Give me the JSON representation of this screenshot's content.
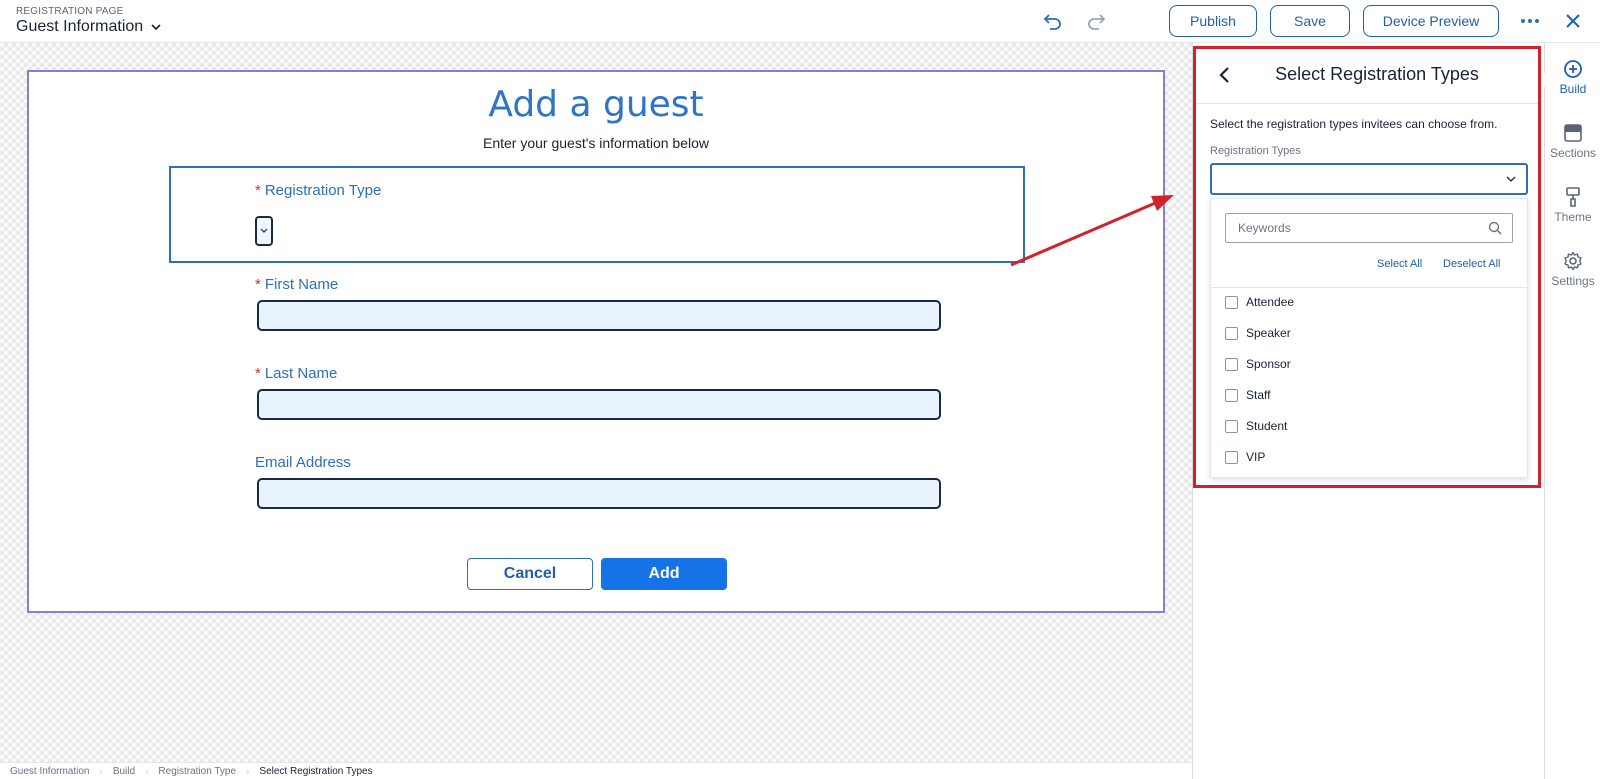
{
  "header": {
    "kicker": "REGISTRATION PAGE",
    "title": "Guest Information",
    "buttons": {
      "publish": "Publish",
      "save": "Save",
      "device_preview": "Device Preview"
    }
  },
  "form": {
    "title": "Add a guest",
    "subtitle": "Enter your guest's information below",
    "required_mark": "*",
    "fields": {
      "registration_type": "Registration Type",
      "first_name": "First Name",
      "last_name": "Last Name",
      "email": "Email Address"
    },
    "cancel_label": "Cancel",
    "add_label": "Add"
  },
  "panel": {
    "title": "Select Registration Types",
    "description": "Select the registration types invitees can choose from.",
    "dropdown_label": "Registration Types",
    "search_placeholder": "Keywords",
    "select_all": "Select All",
    "deselect_all": "Deselect All",
    "options": [
      "Attendee",
      "Speaker",
      "Sponsor",
      "Staff",
      "Student",
      "VIP"
    ]
  },
  "rail": {
    "items": [
      {
        "label": "Build",
        "icon": "plus-circle-icon",
        "active": true
      },
      {
        "label": "Sections",
        "icon": "sections-icon",
        "active": false
      },
      {
        "label": "Theme",
        "icon": "paint-roller-icon",
        "active": false
      },
      {
        "label": "Settings",
        "icon": "gear-icon",
        "active": false
      }
    ]
  },
  "breadcrumb": [
    "Guest Information",
    "Build",
    "Registration Type",
    "Select Registration Types"
  ],
  "colors": {
    "accent": "#1473e6",
    "highlight_box": "#d3202a",
    "card_border": "#8a7bd6",
    "label_blue": "#2e6fb8"
  }
}
